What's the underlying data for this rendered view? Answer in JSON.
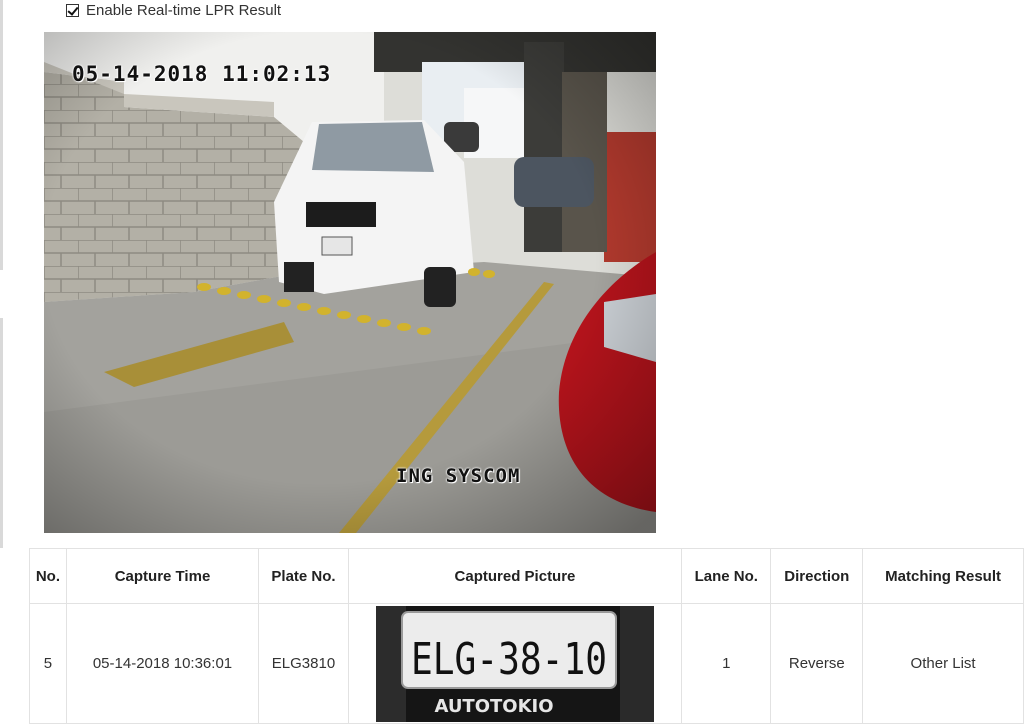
{
  "settings": {
    "realtime_lpr_label": "Enable Real-time LPR Result",
    "realtime_lpr_checked": true
  },
  "live_view": {
    "timestamp": "05-14-2018 11:02:13",
    "camera_name": "ING SYSCOM"
  },
  "results_table": {
    "headers": [
      "No.",
      "Capture Time",
      "Plate No.",
      "Captured Picture",
      "Lane No.",
      "Direction",
      "Matching Result"
    ],
    "rows": [
      {
        "no": "5",
        "capture_time": "05-14-2018 10:36:01",
        "plate_no": "ELG3810",
        "picture_plate_text": "ELG-38-10",
        "picture_dealer_text": "AUTOTOKIO",
        "lane_no": "1",
        "direction": "Reverse",
        "matching_result": "Other List"
      }
    ]
  }
}
